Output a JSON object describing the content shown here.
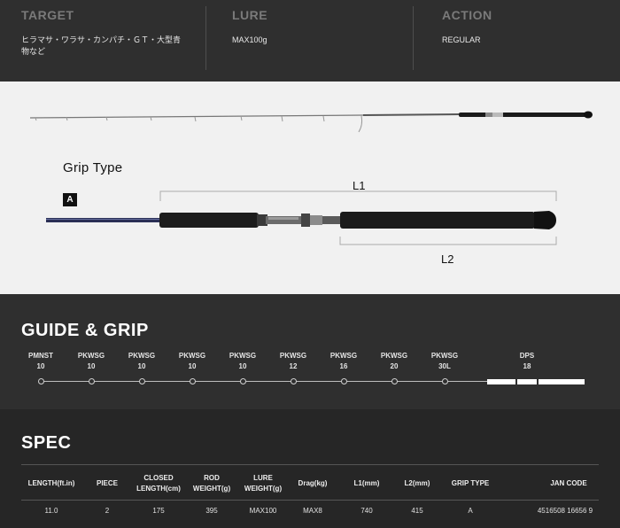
{
  "top": {
    "target": {
      "heading": "TARGET",
      "value": "ヒラマサ・ワラサ・カンパチ・ＧＴ・大型青物など"
    },
    "lure": {
      "heading": "LURE",
      "value": "MAX100g"
    },
    "action": {
      "heading": "ACTION",
      "value": "REGULAR"
    }
  },
  "rod": {
    "grip_title": "Grip Type",
    "grip_badge": "A",
    "l1_label": "L1",
    "l2_label": "L2"
  },
  "guide_grip": {
    "title": "GUIDE & GRIP",
    "guides": [
      {
        "type": "PMNST",
        "size": "10"
      },
      {
        "type": "PKWSG",
        "size": "10"
      },
      {
        "type": "PKWSG",
        "size": "10"
      },
      {
        "type": "PKWSG",
        "size": "10"
      },
      {
        "type": "PKWSG",
        "size": "10"
      },
      {
        "type": "PKWSG",
        "size": "12"
      },
      {
        "type": "PKWSG",
        "size": "16"
      },
      {
        "type": "PKWSG",
        "size": "20"
      },
      {
        "type": "PKWSG",
        "size": "30L"
      }
    ],
    "reel_seat": {
      "type": "DPS",
      "size": "18"
    }
  },
  "spec": {
    "title": "SPEC",
    "headers": [
      "LENGTH(ft.in)",
      "PIECE",
      "CLOSED LENGTH(cm)",
      "ROD WEIGHT(g)",
      "LURE WEIGHT(g)",
      "Drag(kg)",
      "L1(mm)",
      "L2(mm)",
      "GRIP TYPE",
      "JAN CODE"
    ],
    "row": [
      "11.0",
      "2",
      "175",
      "395",
      "MAX100",
      "MAX8",
      "740",
      "415",
      "A",
      "4516508 16656 9"
    ]
  }
}
